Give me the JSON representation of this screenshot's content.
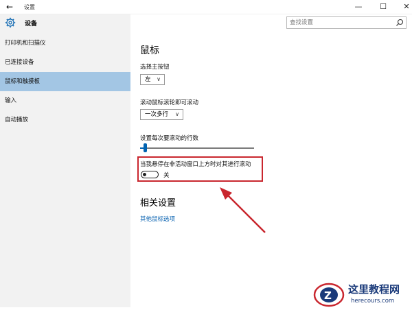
{
  "window": {
    "title": "设置",
    "back_icon": "←",
    "min_icon": "—",
    "max_icon": "☐",
    "close_icon": "✕"
  },
  "sidebar": {
    "header": "设备",
    "items": [
      {
        "label": "打印机和扫描仪",
        "active": false
      },
      {
        "label": "已连接设备",
        "active": false
      },
      {
        "label": "鼠标和触摸板",
        "active": true
      },
      {
        "label": "输入",
        "active": false
      },
      {
        "label": "自动播放",
        "active": false
      }
    ]
  },
  "search": {
    "placeholder": "查找设置"
  },
  "main": {
    "title": "鼠标",
    "primary_button": {
      "label": "选择主按钮",
      "value": "左"
    },
    "scroll_wheel": {
      "label": "滚动鼠标滚轮即可滚动",
      "value": "一次多行"
    },
    "scroll_lines": {
      "label": "设置每次要滚动的行数",
      "value_fraction": 0.03
    },
    "inactive_scroll": {
      "label": "当我悬停在非活动窗口上方时对其进行滚动",
      "state": "关"
    },
    "related_title": "相关设置",
    "related_link": "其他鼠标选项"
  },
  "watermark": {
    "cn": "这里教程网",
    "en": "herecours.com"
  },
  "colors": {
    "accent": "#0063b1",
    "active_nav": "#a3c6e4",
    "highlight": "#c9262e",
    "link": "#0a63b1"
  }
}
